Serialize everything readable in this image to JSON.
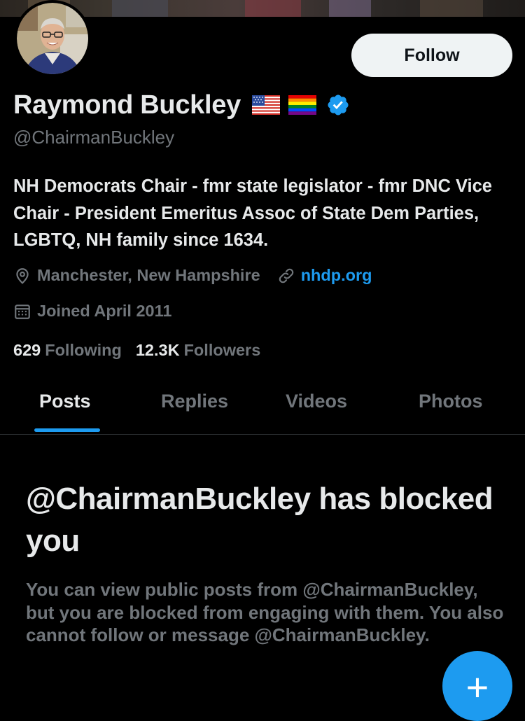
{
  "profile": {
    "name": "Raymond Buckley",
    "handle": "@ChairmanBuckley",
    "flags": [
      "us-flag-icon",
      "rainbow-flag-icon"
    ],
    "verified_icon": "verified-badge-icon",
    "bio": "NH Democrats Chair - fmr state legislator - fmr DNC Vice Chair - President Emeritus Assoc of State Dem Parties, LGBTQ, NH family since 1634.",
    "location": "Manchester, New Hampshire",
    "website": "nhdp.org",
    "joined": "Joined April 2011",
    "following_count": "629",
    "following_label": "Following",
    "followers_count": "12.3K",
    "followers_label": "Followers"
  },
  "actions": {
    "follow_label": "Follow",
    "fab_label": "+"
  },
  "tabs": [
    {
      "label": "Posts",
      "active": true
    },
    {
      "label": "Replies",
      "active": false
    },
    {
      "label": "Videos",
      "active": false
    },
    {
      "label": "Photos",
      "active": false
    }
  ],
  "blocked": {
    "title": "@ChairmanBuckley has blocked you",
    "description": "You can view public posts from @ChairmanBuckley, but you are blocked from engaging with them. You also cannot follow or message @ChairmanBuckley."
  },
  "colors": {
    "background": "#000000",
    "primary_text": "#e7e9ea",
    "secondary_text": "#71767b",
    "accent": "#1d9bf0",
    "follow_button_bg": "#eff3f4"
  }
}
